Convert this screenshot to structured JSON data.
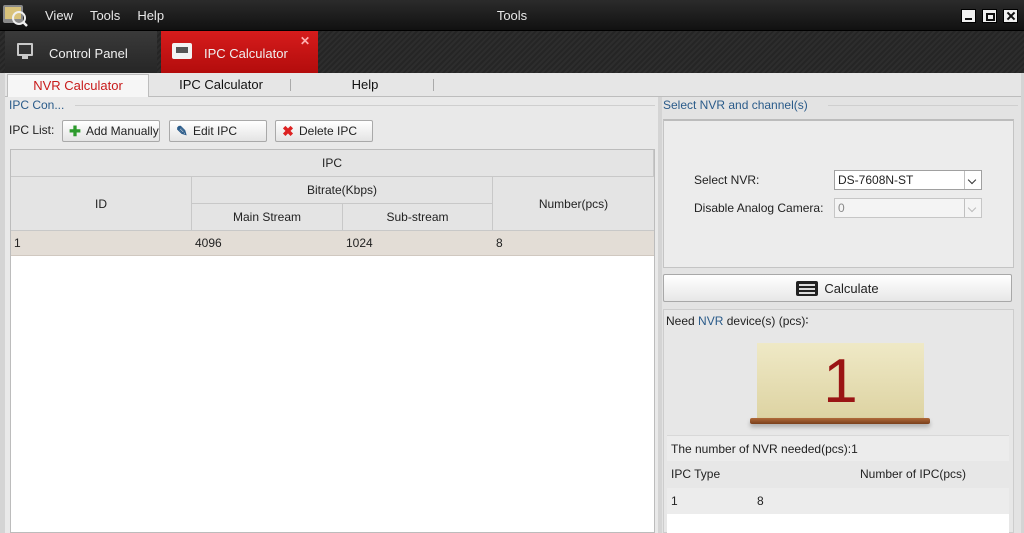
{
  "window": {
    "title": "Tools",
    "menu": [
      "View",
      "Tools",
      "Help"
    ],
    "controls": [
      "minimize-icon",
      "maximize-icon",
      "close-icon"
    ]
  },
  "app_tabs": [
    {
      "label": "Control Panel",
      "icon": "monitor-icon",
      "active": false
    },
    {
      "label": "IPC Calculator",
      "icon": "calculator-icon",
      "active": true,
      "close": "✕"
    }
  ],
  "sub_tabs": [
    {
      "label": "NVR Calculator",
      "active": true
    },
    {
      "label": "IPC Calculator",
      "active": false
    },
    {
      "label": "Help",
      "active": false
    }
  ],
  "left": {
    "section_title": "IPC Con...",
    "ipc_list_label": "IPC List:",
    "buttons": {
      "add": "Add Manually",
      "edit": "Edit IPC",
      "delete": "Delete IPC"
    },
    "table": {
      "group_header": "IPC",
      "col_id": "ID",
      "bitrate_header": "Bitrate(Kbps)",
      "col_main": "Main Stream",
      "col_sub": "Sub-stream",
      "col_number": "Number(pcs)",
      "rows": [
        {
          "id": "1",
          "main": "4096",
          "sub": "1024",
          "number": "8"
        }
      ]
    }
  },
  "right": {
    "section_title": "Select NVR and channel(s)",
    "select_nvr_label": "Select NVR:",
    "select_nvr_value": "DS-7608N-ST",
    "disable_analog_label": "Disable Analog Camera:",
    "disable_analog_value": "0",
    "calculate_label": "Calculate",
    "need_prefix": "Need",
    "need_nvr": "NVR",
    "need_suffix": "device(s)  (pcs)∶",
    "result_number": "1",
    "needed_text": "The number of NVR needed(pcs):1",
    "ipc_type_header": "IPC Type",
    "ipc_number_header": "Number of IPC(pcs)",
    "ipc_row": {
      "type": "1",
      "number": "8"
    }
  },
  "colors": {
    "accent_red": "#c81a1a",
    "active_tab_red": "#d61c1c",
    "section_blue": "#2a5b8a",
    "result_digit": "#9a1414"
  }
}
